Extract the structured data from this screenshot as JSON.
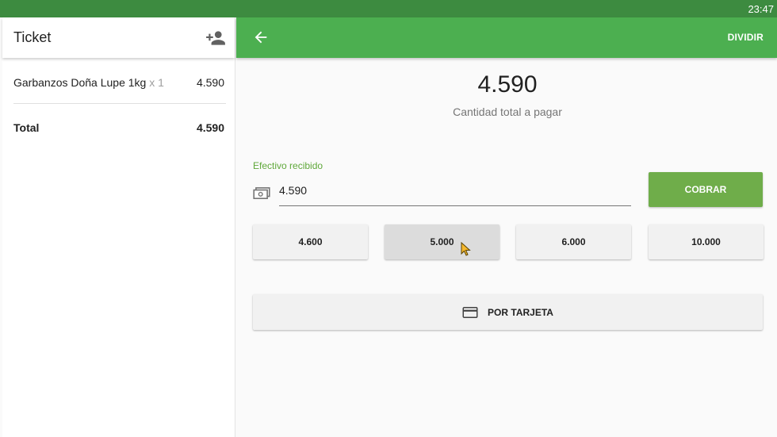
{
  "status_bar": {
    "time": "23:47"
  },
  "ticket": {
    "title": "Ticket",
    "add_customer_icon": "person-add-icon",
    "lines": [
      {
        "name": "Garbanzos Doña Lupe 1kg",
        "qty": "x 1",
        "amount": "4.590"
      }
    ],
    "total_label": "Total",
    "total_amount": "4.590"
  },
  "payment": {
    "back_icon": "arrow-back-icon",
    "divide_label": "DIVIDIR",
    "total_amount": "4.590",
    "total_label": "Cantidad total a pagar",
    "cash_label": "Efectivo recibido",
    "cash_icon": "money-icon",
    "cash_value": "4.590",
    "charge_label": "COBRAR",
    "quick_amounts": [
      "4.600",
      "5.000",
      "6.000",
      "10.000"
    ],
    "card_label": "POR TARJETA",
    "card_icon": "credit-card-icon"
  },
  "colors": {
    "appbar": "#4caf50",
    "statusbar": "#3d8b40",
    "charge_button": "#6fad4a",
    "accent_label": "#5fa83a"
  }
}
